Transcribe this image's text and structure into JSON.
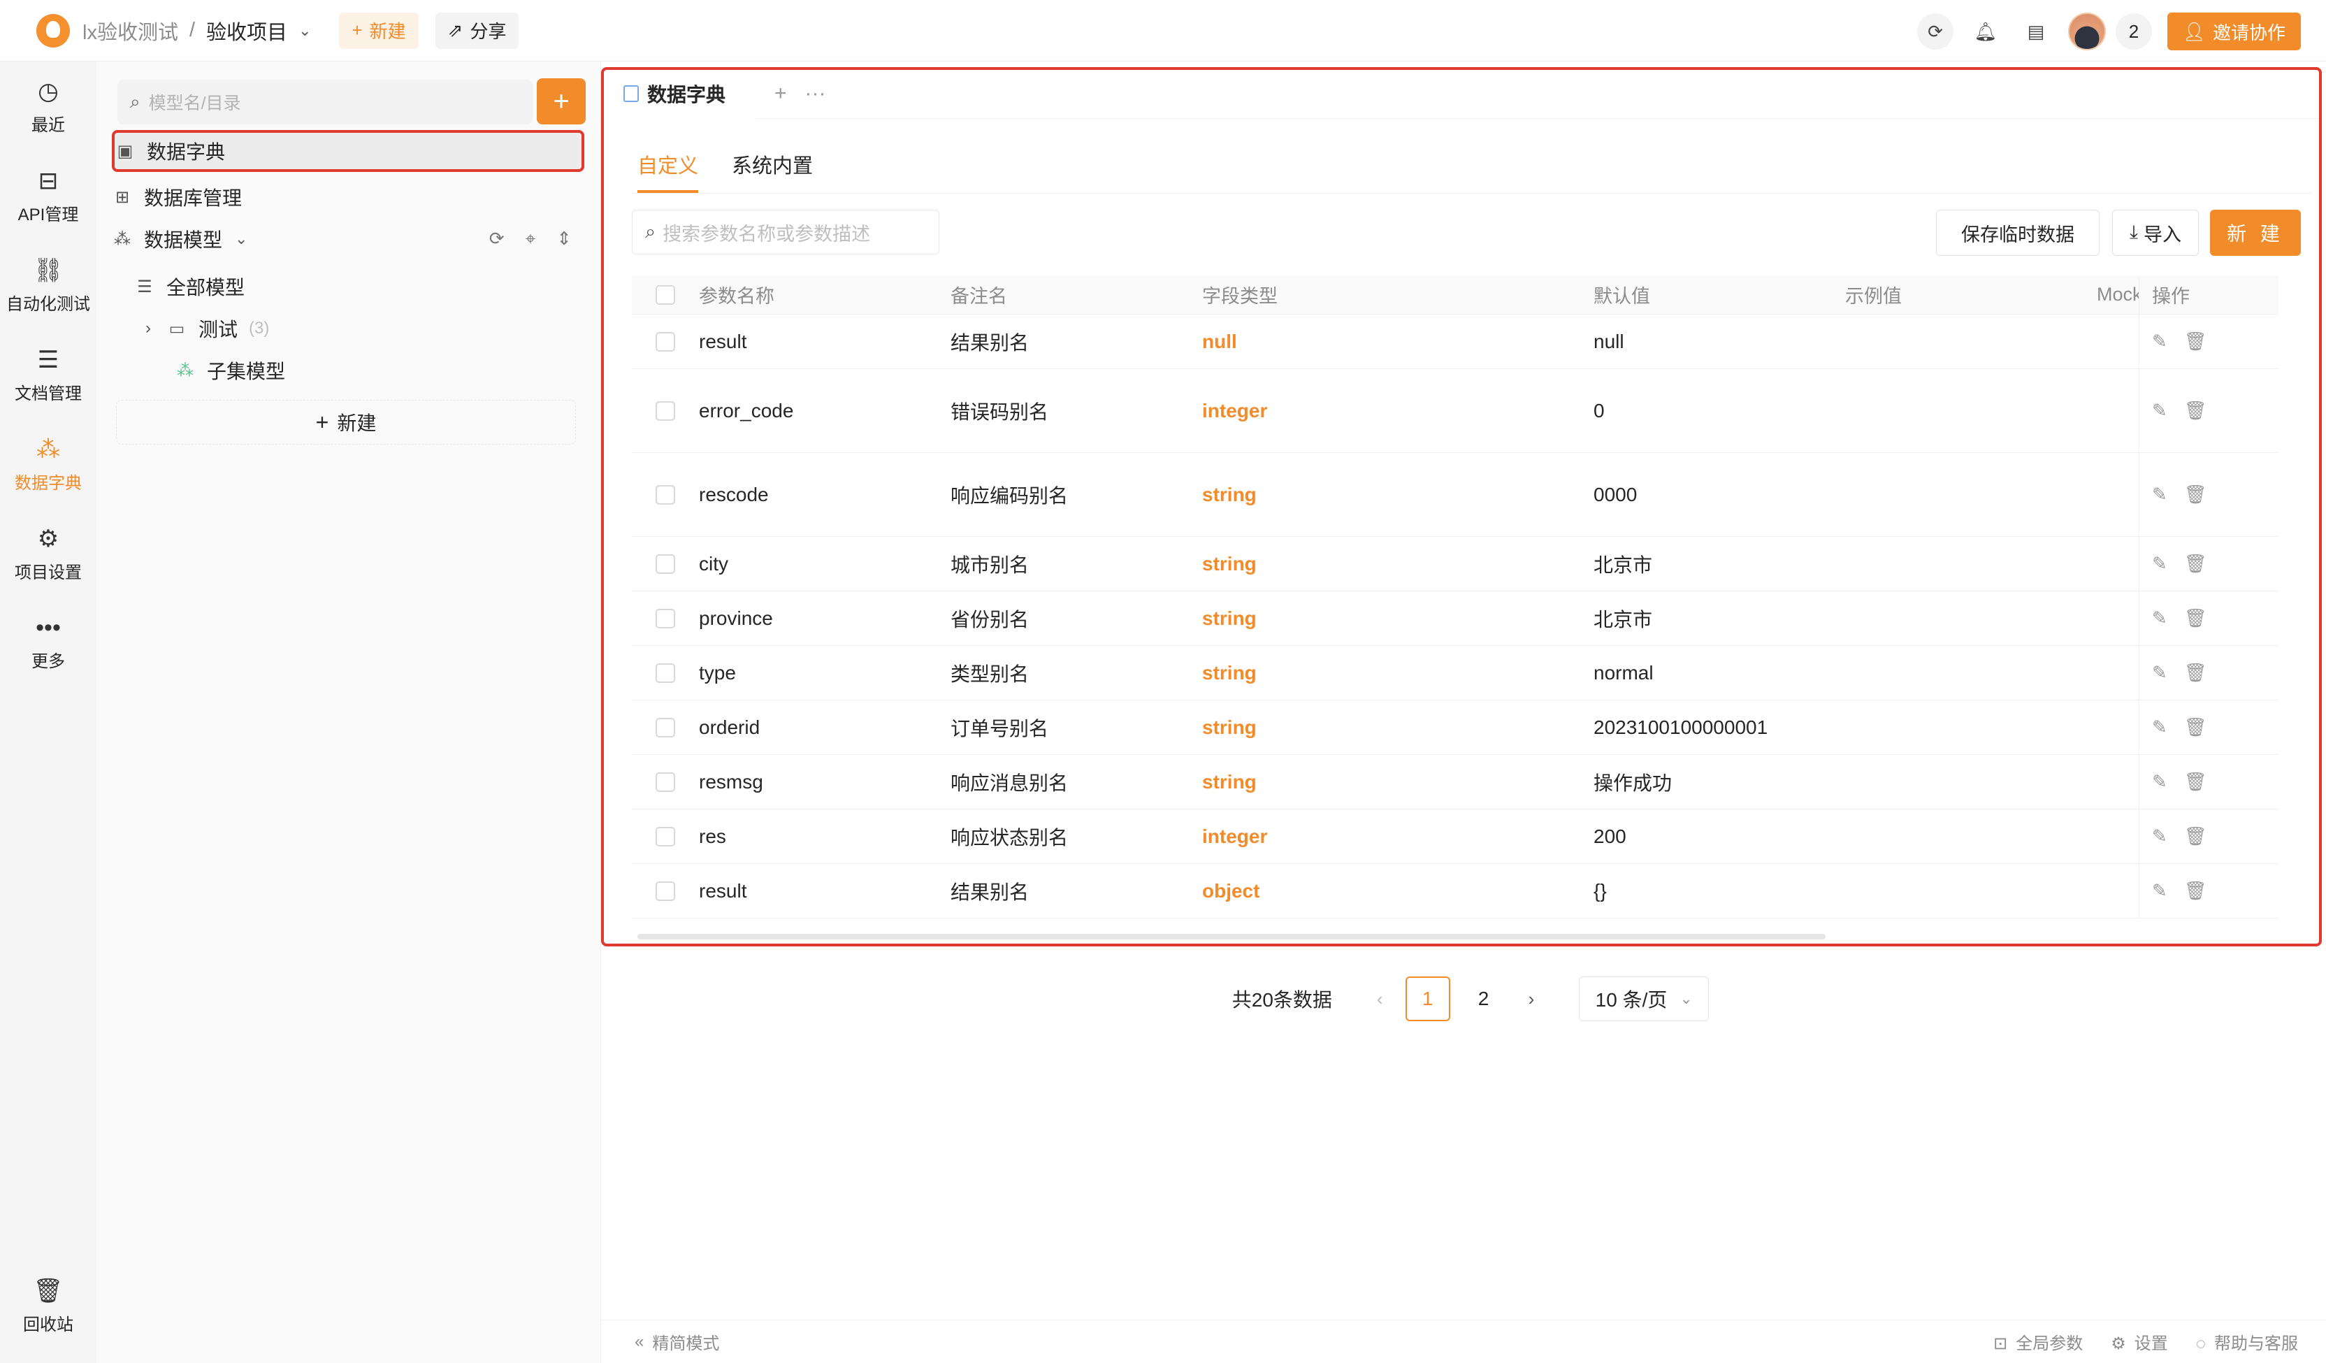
{
  "header": {
    "team": "lx验收测试",
    "separator": "/",
    "project": "验收项目",
    "new_label": "新建",
    "share_label": "分享",
    "member_count": "2",
    "invite_label": "邀请协作"
  },
  "leftnav": [
    {
      "label": "最近",
      "icon": "clock-icon",
      "glyph": "◷"
    },
    {
      "label": "API管理",
      "icon": "api-icon",
      "glyph": "⊟"
    },
    {
      "label": "自动化测试",
      "icon": "automation-icon",
      "glyph": "⛓"
    },
    {
      "label": "文档管理",
      "icon": "document-icon",
      "glyph": "☰"
    },
    {
      "label": "数据字典",
      "icon": "data-dictionary-icon",
      "glyph": "⁂"
    },
    {
      "label": "项目设置",
      "icon": "settings-icon",
      "glyph": "⚙"
    },
    {
      "label": "更多",
      "icon": "more-icon",
      "glyph": "•••"
    }
  ],
  "recycle_label": "回收站",
  "tree": {
    "search_placeholder": "模型名/目录",
    "items": {
      "dict": "数据字典",
      "db": "数据库管理",
      "model": "数据模型",
      "all_models": "全部模型",
      "folder": "测试",
      "folder_count": "(3)",
      "subset": "子集模型"
    },
    "new_label": "新建"
  },
  "tab": {
    "title": "数据字典",
    "add": "+",
    "more": "···"
  },
  "subtabs": [
    "自定义",
    "系统内置"
  ],
  "toolbar": {
    "search_placeholder": "搜索参数名称或参数描述",
    "save_temp": "保存临时数据",
    "import": "导入",
    "new": "新 建"
  },
  "table": {
    "headers": [
      "参数名称",
      "备注名",
      "字段类型",
      "默认值",
      "示例值",
      "Mock",
      "操作"
    ],
    "rows": [
      {
        "name": "result",
        "alias": "结果别名",
        "type": "null",
        "default": "null",
        "example": ""
      },
      {
        "name": "error_code",
        "alias": "错误码别名",
        "type": "integer",
        "default": "0",
        "example": ""
      },
      {
        "name": "rescode",
        "alias": "响应编码别名",
        "type": "string",
        "default": "0000",
        "example": ""
      },
      {
        "name": "city",
        "alias": "城市别名",
        "type": "string",
        "default": "北京市",
        "example": ""
      },
      {
        "name": "province",
        "alias": "省份别名",
        "type": "string",
        "default": "北京市",
        "example": ""
      },
      {
        "name": "type",
        "alias": "类型别名",
        "type": "string",
        "default": "normal",
        "example": ""
      },
      {
        "name": "orderid",
        "alias": "订单号别名",
        "type": "string",
        "default": "2023100100000001",
        "example": ""
      },
      {
        "name": "resmsg",
        "alias": "响应消息别名",
        "type": "string",
        "default": "操作成功",
        "example": ""
      },
      {
        "name": "res",
        "alias": "响应状态别名",
        "type": "integer",
        "default": "200",
        "example": ""
      },
      {
        "name": "result",
        "alias": "结果别名",
        "type": "object",
        "default": "{}",
        "example": ""
      }
    ]
  },
  "pagination": {
    "total": "共20条数据",
    "pages": [
      "1",
      "2"
    ],
    "current": "1",
    "page_size": "10 条/页"
  },
  "statusbar": {
    "simple_mode": "精简模式",
    "global_params": "全局参数",
    "settings": "设置",
    "help": "帮助与客服"
  },
  "colors": {
    "accent": "#f28c2b",
    "highlight_border": "#e03a2f"
  }
}
